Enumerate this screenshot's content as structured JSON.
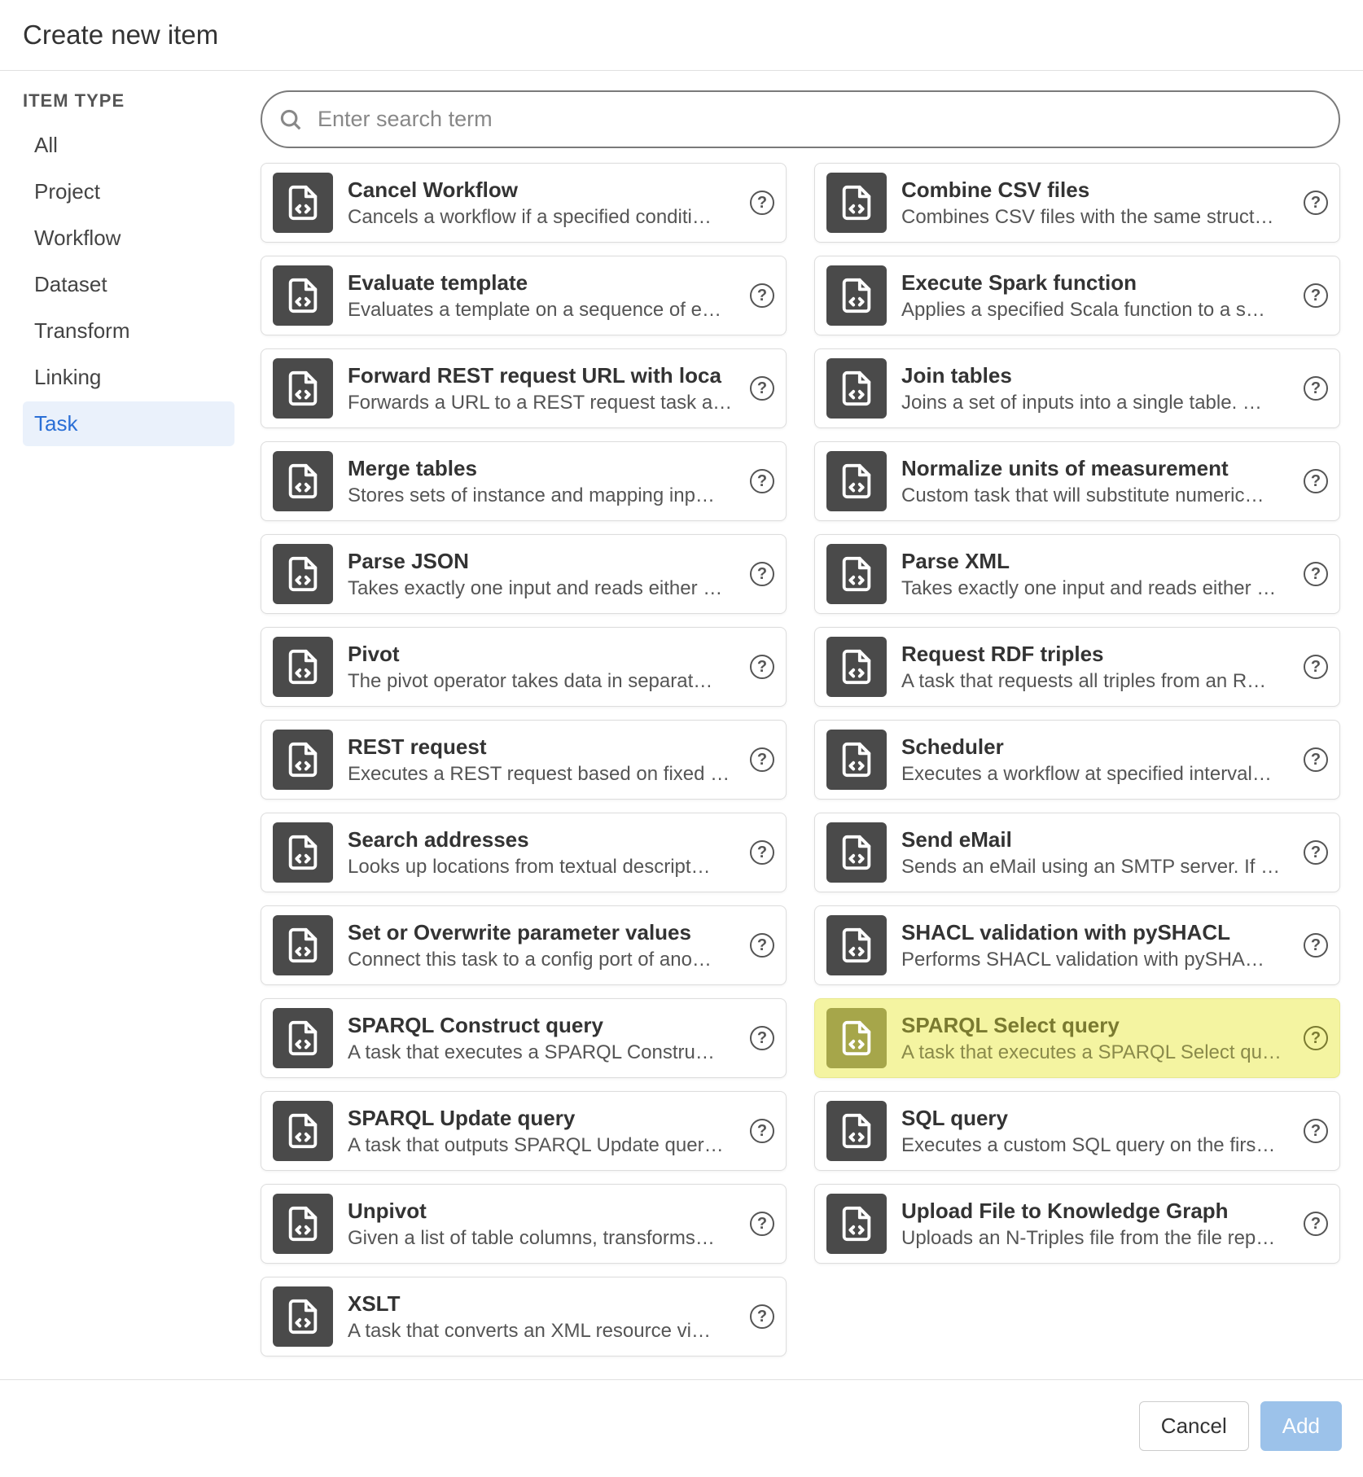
{
  "header": {
    "title": "Create new item"
  },
  "sidebar": {
    "header": "ITEM TYPE",
    "items": [
      {
        "label": "All",
        "selected": false
      },
      {
        "label": "Project",
        "selected": false
      },
      {
        "label": "Workflow",
        "selected": false
      },
      {
        "label": "Dataset",
        "selected": false
      },
      {
        "label": "Transform",
        "selected": false
      },
      {
        "label": "Linking",
        "selected": false
      },
      {
        "label": "Task",
        "selected": true
      }
    ]
  },
  "search": {
    "placeholder": "Enter search term"
  },
  "items_left": [
    {
      "title": "Cancel Workflow",
      "desc": "Cancels a workflow if a specified conditi…",
      "highlighted": false
    },
    {
      "title": "Evaluate template",
      "desc": "Evaluates a template on a sequence of e…",
      "highlighted": false
    },
    {
      "title": "Forward REST request URL with loca",
      "desc": "Forwards a URL to a REST request task a…",
      "highlighted": false
    },
    {
      "title": "Merge tables",
      "desc": "Stores sets of instance and mapping inp…",
      "highlighted": false
    },
    {
      "title": "Parse JSON",
      "desc": "Takes exactly one input and reads either …",
      "highlighted": false
    },
    {
      "title": "Pivot",
      "desc": "The pivot operator takes data in separat…",
      "highlighted": false
    },
    {
      "title": "REST request",
      "desc": "Executes a REST request based on fixed …",
      "highlighted": false
    },
    {
      "title": "Search addresses",
      "desc": "Looks up locations from textual descript…",
      "highlighted": false
    },
    {
      "title": "Set or Overwrite parameter values",
      "desc": "Connect this task to a config port of ano…",
      "highlighted": false
    },
    {
      "title": "SPARQL Construct query",
      "desc": "A task that executes a SPARQL Constru…",
      "highlighted": false
    },
    {
      "title": "SPARQL Update query",
      "desc": "A task that outputs SPARQL Update quer…",
      "highlighted": false
    },
    {
      "title": "Unpivot",
      "desc": "Given a list of table columns, transforms…",
      "highlighted": false
    },
    {
      "title": "XSLT",
      "desc": "A task that converts an XML resource vi…",
      "highlighted": false
    }
  ],
  "items_right": [
    {
      "title": "Combine CSV files",
      "desc": "Combines CSV files with the same struct…",
      "highlighted": false
    },
    {
      "title": "Execute Spark function",
      "desc": "Applies a specified Scala function to a s…",
      "highlighted": false
    },
    {
      "title": "Join tables",
      "desc": "Joins a set of inputs into a single table. …",
      "highlighted": false
    },
    {
      "title": "Normalize units of measurement",
      "desc": "Custom task that will substitute numeric…",
      "highlighted": false
    },
    {
      "title": "Parse XML",
      "desc": "Takes exactly one input and reads either …",
      "highlighted": false
    },
    {
      "title": "Request RDF triples",
      "desc": "A task that requests all triples from an R…",
      "highlighted": false
    },
    {
      "title": "Scheduler",
      "desc": "Executes a workflow at specified interval…",
      "highlighted": false
    },
    {
      "title": "Send eMail",
      "desc": "Sends an eMail using an SMTP server. If …",
      "highlighted": false
    },
    {
      "title": "SHACL validation with pySHACL",
      "desc": "Performs SHACL validation with pySHA…",
      "highlighted": false
    },
    {
      "title": "SPARQL Select query",
      "desc": "A task that executes a SPARQL Select qu…",
      "highlighted": true
    },
    {
      "title": "SQL query",
      "desc": "Executes a custom SQL query on the firs…",
      "highlighted": false
    },
    {
      "title": "Upload File to Knowledge Graph",
      "desc": "Uploads an N-Triples file from the file rep…",
      "highlighted": false
    }
  ],
  "footer": {
    "cancel": "Cancel",
    "add": "Add"
  }
}
